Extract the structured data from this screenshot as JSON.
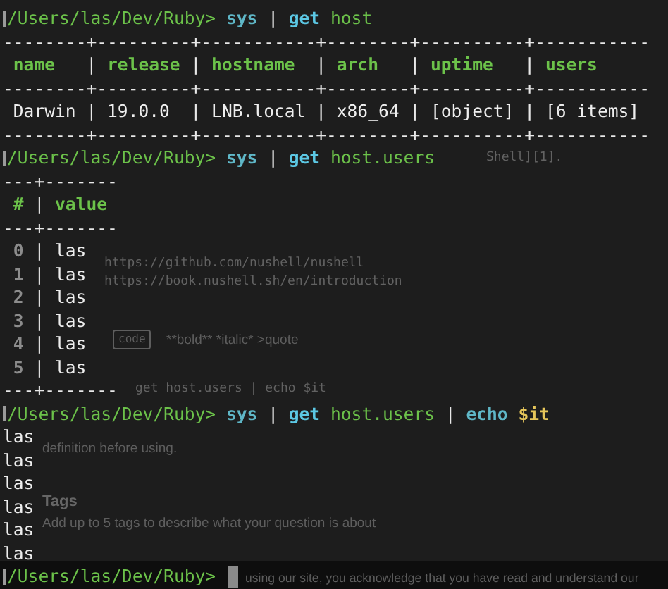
{
  "background_page": {
    "lines": [
      {
        "text": "Shell][1].",
        "kind": "mono"
      },
      {
        "text": "https://github.com/nushell/nushell",
        "kind": "mono"
      },
      {
        "text": "https://book.nushell.sh/en/introduction",
        "kind": "mono"
      },
      {
        "text": "code",
        "kind": "code"
      },
      {
        "text": "**bold**  *italic*  >quote",
        "kind": "sans"
      },
      {
        "text": "get host.users | echo $it",
        "kind": "mono"
      },
      {
        "text": "definition before using.",
        "kind": "sans"
      },
      {
        "text": "Tags",
        "kind": "heading"
      },
      {
        "text": "Add up to 5 tags to describe what your question is about",
        "kind": "sans"
      },
      {
        "text": "using our site, you acknowledge that you have read and understand our",
        "kind": "sans"
      }
    ]
  },
  "commands": [
    {
      "prompt": "/Users/las/Dev/Ruby>",
      "tokens": [
        {
          "text": "sys",
          "kind": "command"
        },
        {
          "text": "|",
          "kind": "pipe"
        },
        {
          "text": "get",
          "kind": "subcommand"
        },
        {
          "text": "host",
          "kind": "argument"
        }
      ],
      "output": {
        "kind": "table",
        "separator": "|",
        "index_column": false,
        "rules": {
          "top": "--------+---------+-----------+--------+----------+-----------",
          "middle": "--------+---------+-----------+--------+----------+-----------",
          "bottom": "--------+---------+-----------+--------+----------+-----------"
        },
        "columns": [
          "name",
          "release",
          "hostname",
          "arch",
          "uptime",
          "users"
        ],
        "rows": [
          [
            "Darwin",
            "19.0.0",
            "LNB.local",
            "x86_64",
            "[object]",
            "[6 items]"
          ]
        ]
      }
    },
    {
      "prompt": "/Users/las/Dev/Ruby>",
      "tokens": [
        {
          "text": "sys",
          "kind": "command"
        },
        {
          "text": "|",
          "kind": "pipe"
        },
        {
          "text": "get",
          "kind": "subcommand"
        },
        {
          "text": "host.users",
          "kind": "argument"
        }
      ],
      "output": {
        "kind": "table",
        "separator": "|",
        "index_column": true,
        "rules": {
          "top": "---+-------",
          "middle": "---+-------",
          "bottom": "---+-------"
        },
        "columns": [
          "#",
          "value"
        ],
        "rows": [
          [
            "0",
            "las"
          ],
          [
            "1",
            "las"
          ],
          [
            "2",
            "las"
          ],
          [
            "3",
            "las"
          ],
          [
            "4",
            "las"
          ],
          [
            "5",
            "las"
          ]
        ]
      }
    },
    {
      "prompt": "/Users/las/Dev/Ruby>",
      "tokens": [
        {
          "text": "sys",
          "kind": "command"
        },
        {
          "text": "|",
          "kind": "pipe"
        },
        {
          "text": "get",
          "kind": "subcommand"
        },
        {
          "text": "host.users",
          "kind": "argument"
        },
        {
          "text": "|",
          "kind": "pipe"
        },
        {
          "text": "echo",
          "kind": "command"
        },
        {
          "text": "$it",
          "kind": "variable"
        }
      ],
      "output": {
        "kind": "lines",
        "lines": [
          "las",
          "las",
          "las",
          "las",
          "las",
          "las"
        ]
      }
    },
    {
      "prompt": "/Users/las/Dev/Ruby>",
      "cursor": true
    }
  ]
}
